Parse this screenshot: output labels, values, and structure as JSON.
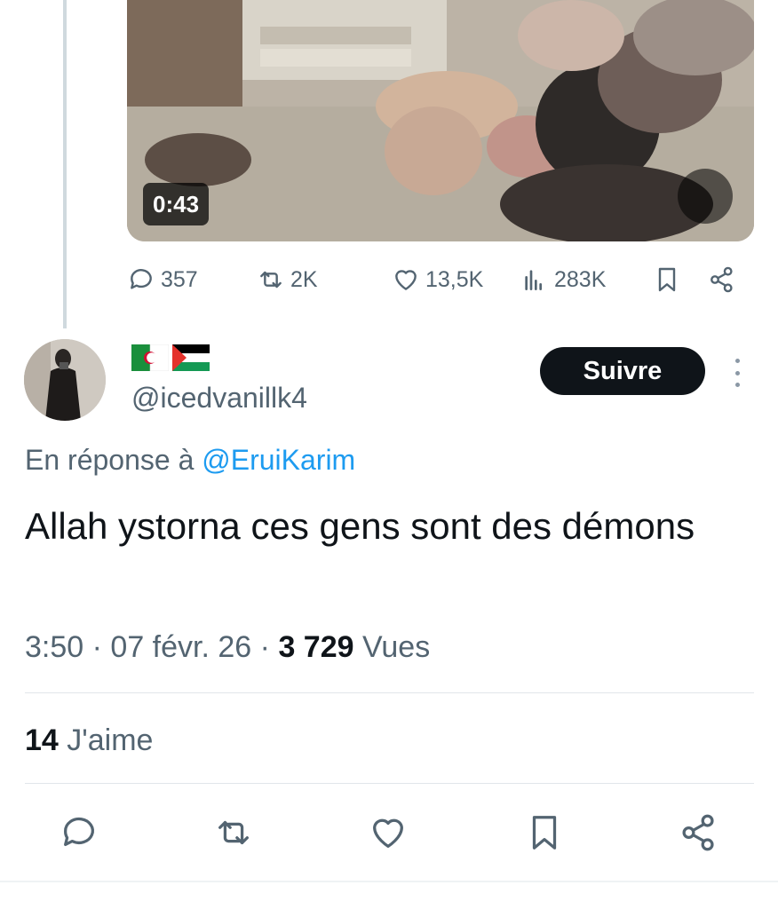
{
  "video": {
    "duration": "0:43"
  },
  "parent_tweet_stats": {
    "replies": "357",
    "reposts": "2K",
    "likes": "13,5K",
    "views": "283K"
  },
  "reply_tweet": {
    "handle": "@icedvanillk4",
    "flags": [
      "flag-algeria-icon",
      "flag-palestine-icon"
    ],
    "follow_label": "Suivre",
    "reply_prefix": "En réponse à",
    "reply_mention": "@EruiKarim",
    "text": "Allah ystorna ces gens sont des démons",
    "time": "3:50",
    "separator": "·",
    "date": "07 févr. 26",
    "views_count": "3 729",
    "views_label": "Vues",
    "likes_count": "14",
    "likes_label": "J'aime"
  },
  "colors": {
    "text_primary": "#0f1419",
    "text_secondary": "#536471",
    "link": "#1d9bf0",
    "follow_button_bg": "#0f1419"
  }
}
